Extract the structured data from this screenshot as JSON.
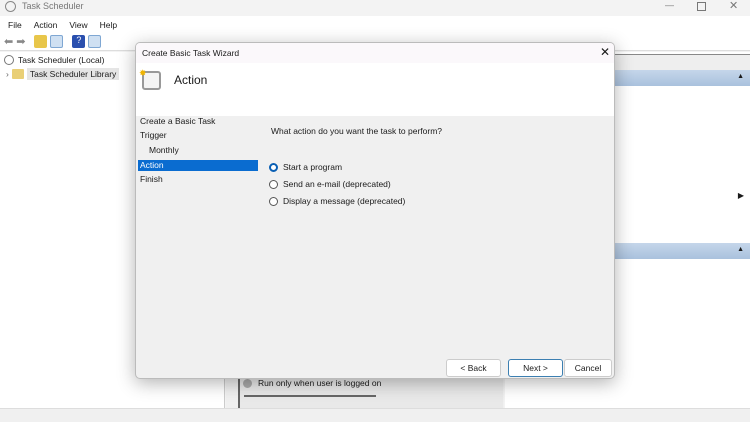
{
  "app": {
    "title": "Task Scheduler",
    "menu": [
      "File",
      "Action",
      "View",
      "Help"
    ]
  },
  "tree": {
    "root": "Task Scheduler (Local)",
    "library": "Task Scheduler Library"
  },
  "background": {
    "run_option": "Run only when user is logged on"
  },
  "dialog": {
    "title": "Create Basic Task Wizard",
    "header": "Action",
    "steps": [
      "Create a Basic Task",
      "Trigger",
      "Monthly",
      "Action",
      "Finish"
    ],
    "active_step": "Action",
    "question": "What action do you want the task to perform?",
    "options": [
      {
        "label": "Start a program",
        "selected": true
      },
      {
        "label": "Send an e-mail (deprecated)",
        "selected": false
      },
      {
        "label": "Display a message (deprecated)",
        "selected": false
      }
    ],
    "buttons": {
      "back": "< Back",
      "next": "Next >",
      "cancel": "Cancel"
    }
  }
}
